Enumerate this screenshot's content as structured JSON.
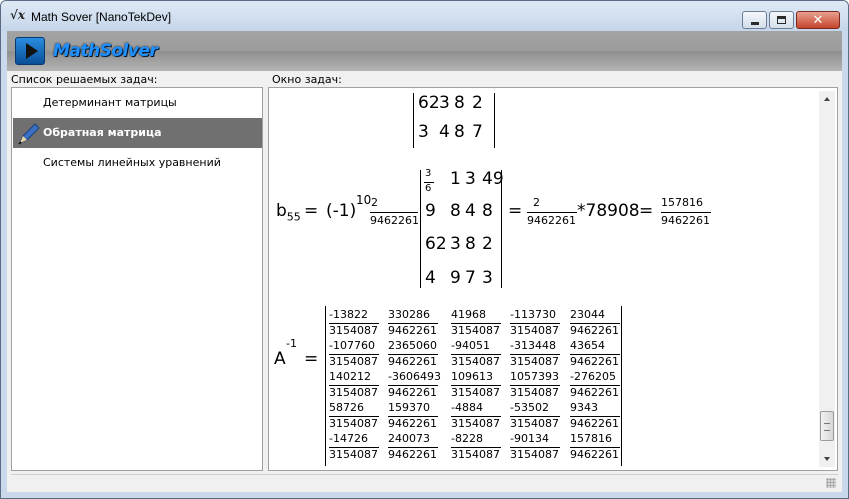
{
  "window": {
    "title": "Math Sover [NanoTekDev]",
    "icon": "sqrt-x-icon"
  },
  "banner": {
    "logo_text": "MathSolver"
  },
  "left_panel": {
    "label": "Список решаемых задач:",
    "items": [
      {
        "label": "Детерминант матрицы",
        "selected": false
      },
      {
        "label": "Обратная матрица",
        "selected": true,
        "icon": "pen-icon"
      },
      {
        "label": "Системы линейных уравнений",
        "selected": false
      }
    ]
  },
  "right_panel": {
    "label": "Окно задач:"
  },
  "work": {
    "top_matrix_rows": [
      [
        "62",
        "3",
        "8",
        "2"
      ],
      [
        "3",
        "4",
        "8",
        "7"
      ]
    ],
    "b55": {
      "lhs": "b",
      "lhs_sub": "55",
      "sign_base": "(-1)",
      "exponent": "10",
      "coef_num": "2",
      "coef_den": "9462261",
      "minor_first_num": "3",
      "minor_first_den": "6",
      "minor_rows": [
        [
          "",
          "1",
          "3",
          "49"
        ],
        [
          "9",
          "8",
          "4",
          "8"
        ],
        [
          "62",
          "3",
          "8",
          "2"
        ],
        [
          "4",
          "9",
          "7",
          "3"
        ]
      ],
      "mid_num": "2",
      "mid_den": "9462261",
      "mult": "*78908",
      "res_num": "157816",
      "res_den": "9462261"
    },
    "inverse": {
      "lhs": "A",
      "sup": "-1",
      "eq": "=",
      "rows": [
        [
          [
            "-13822",
            "3154087"
          ],
          [
            "330286",
            "9462261"
          ],
          [
            "41968",
            "3154087"
          ],
          [
            "-113730",
            "3154087"
          ],
          [
            "23044",
            "9462261"
          ]
        ],
        [
          [
            "-107760",
            "3154087"
          ],
          [
            "2365060",
            "9462261"
          ],
          [
            "-94051",
            "3154087"
          ],
          [
            "-313448",
            "3154087"
          ],
          [
            "43654",
            "9462261"
          ]
        ],
        [
          [
            "140212",
            "3154087"
          ],
          [
            "-3606493",
            "9462261"
          ],
          [
            "109613",
            "3154087"
          ],
          [
            "1057393",
            "3154087"
          ],
          [
            "-276205",
            "9462261"
          ]
        ],
        [
          [
            "58726",
            "3154087"
          ],
          [
            "159370",
            "9462261"
          ],
          [
            "-4884",
            "3154087"
          ],
          [
            "-53502",
            "3154087"
          ],
          [
            "9343",
            "9462261"
          ]
        ],
        [
          [
            "-14726",
            "3154087"
          ],
          [
            "240073",
            "9462261"
          ],
          [
            "-8228",
            "3154087"
          ],
          [
            "-90134",
            "3154087"
          ],
          [
            "157816",
            "9462261"
          ]
        ]
      ]
    }
  }
}
